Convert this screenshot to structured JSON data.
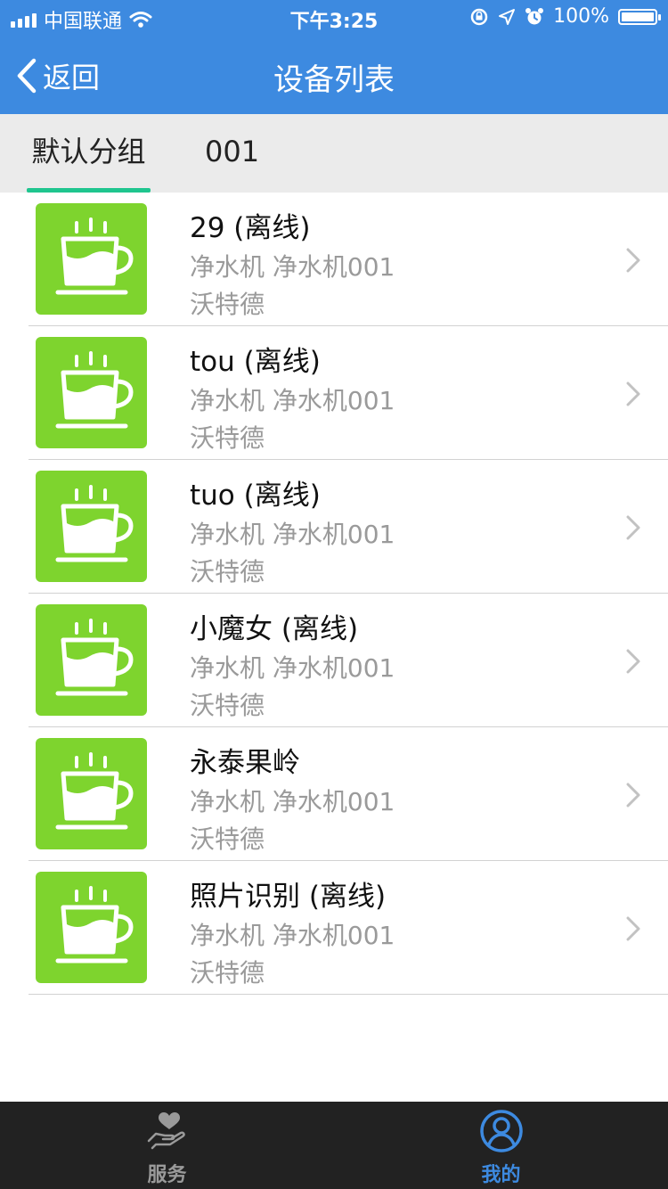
{
  "status_bar": {
    "carrier": "中国联通",
    "time": "下午3:25",
    "battery": "100%"
  },
  "nav": {
    "back_label": "返回",
    "title": "设备列表"
  },
  "tabs": [
    {
      "label": "默认分组",
      "active": true
    },
    {
      "label": "001",
      "active": false
    }
  ],
  "devices": [
    {
      "name": "29 (离线)",
      "type": "净水机 净水机001",
      "brand": "沃特德",
      "icon": "coffee-cup-icon"
    },
    {
      "name": "tou (离线)",
      "type": "净水机 净水机001",
      "brand": "沃特德",
      "icon": "coffee-cup-icon"
    },
    {
      "name": "tuo (离线)",
      "type": "净水机 净水机001",
      "brand": "沃特德",
      "icon": "coffee-cup-icon"
    },
    {
      "name": "小魔女 (离线)",
      "type": "净水机 净水机001",
      "brand": "沃特德",
      "icon": "coffee-cup-icon"
    },
    {
      "name": "永泰果岭",
      "type": "净水机 净水机001",
      "brand": "沃特德",
      "icon": "coffee-cup-icon"
    },
    {
      "name": "照片识别 (离线)",
      "type": "净水机 净水机001",
      "brand": "沃特德",
      "icon": "coffee-cup-icon"
    }
  ],
  "tab_bar": [
    {
      "label": "服务",
      "icon": "service-hand-heart-icon",
      "active": false
    },
    {
      "label": "我的",
      "icon": "user-profile-icon",
      "active": true
    }
  ],
  "colors": {
    "header": "#3d8ae0",
    "tab_indicator": "#1fc58f",
    "thumb_bg": "#7ed42e",
    "tabbar_bg": "#222222",
    "tabbar_active": "#3d8ae0",
    "tabbar_inactive": "#9a9a9a"
  }
}
